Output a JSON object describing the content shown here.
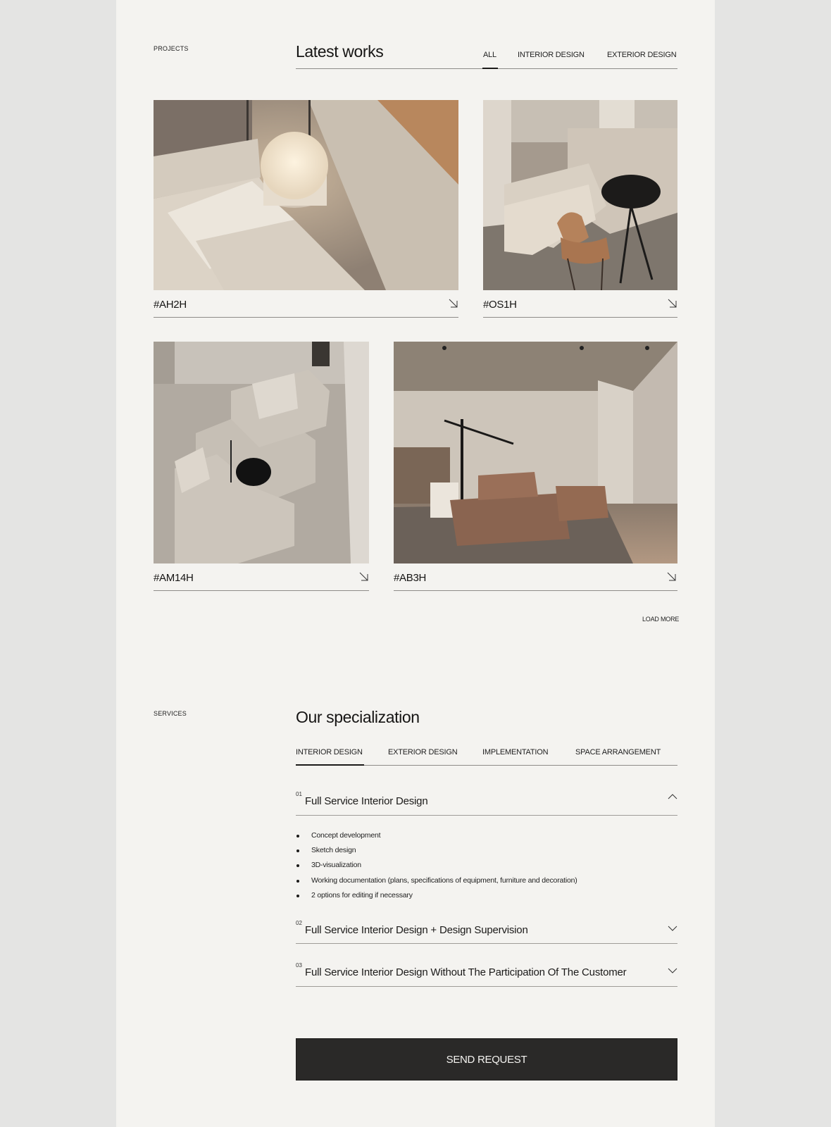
{
  "projects": {
    "section_label": "PROJECTS",
    "title": "Latest works",
    "filters": [
      {
        "label": "ALL",
        "active": true
      },
      {
        "label": "INTERIOR DESIGN",
        "active": false
      },
      {
        "label": "EXTERIOR DESIGN",
        "active": false
      }
    ],
    "cards": [
      {
        "code": "#AH2H",
        "icon": "arrow-down-right-icon",
        "scene": "bedroom with round bedside lamp"
      },
      {
        "code": "#OS1H",
        "icon": "arrow-down-right-icon",
        "scene": "sofa corner with black round table and wooden chair"
      },
      {
        "code": "#AM14H",
        "icon": "arrow-down-right-icon",
        "scene": "top view of grey modular sofa"
      },
      {
        "code": "#AB3H",
        "icon": "arrow-down-right-icon",
        "scene": "living room with brown sofa and floor lamp"
      }
    ],
    "load_more": "LOAD MORE"
  },
  "services": {
    "section_label": "SERVICES",
    "title": "Our specialization",
    "tabs": [
      {
        "label": "INTERIOR DESIGN",
        "active": true
      },
      {
        "label": "EXTERIOR DESIGN",
        "active": false
      },
      {
        "label": "IMPLEMENTATION",
        "active": false
      },
      {
        "label": "SPACE ARRANGEMENT",
        "active": false
      }
    ],
    "accordion": [
      {
        "num": "01",
        "title": "Full Service Interior Design",
        "expanded": true,
        "icon": "chevron-up-icon",
        "items": [
          "Concept development",
          "Sketch design",
          "3D-visualization",
          "Working documentation (plans, specifications of equipment, furniture and decoration)",
          "2 options for editing if necessary"
        ]
      },
      {
        "num": "02",
        "title": "Full Service Interior Design + Design Supervision",
        "expanded": false,
        "icon": "chevron-down-icon"
      },
      {
        "num": "03",
        "title": "Full Service Interior Design Without The Participation Of The Customer",
        "expanded": false,
        "icon": "chevron-down-icon"
      }
    ],
    "cta": "SEND REQUEST"
  },
  "colors": {
    "page_bg": "#f4f3f0",
    "outer_bg": "#e4e4e3",
    "text": "#1b1a19",
    "button_bg": "#2a2928"
  }
}
